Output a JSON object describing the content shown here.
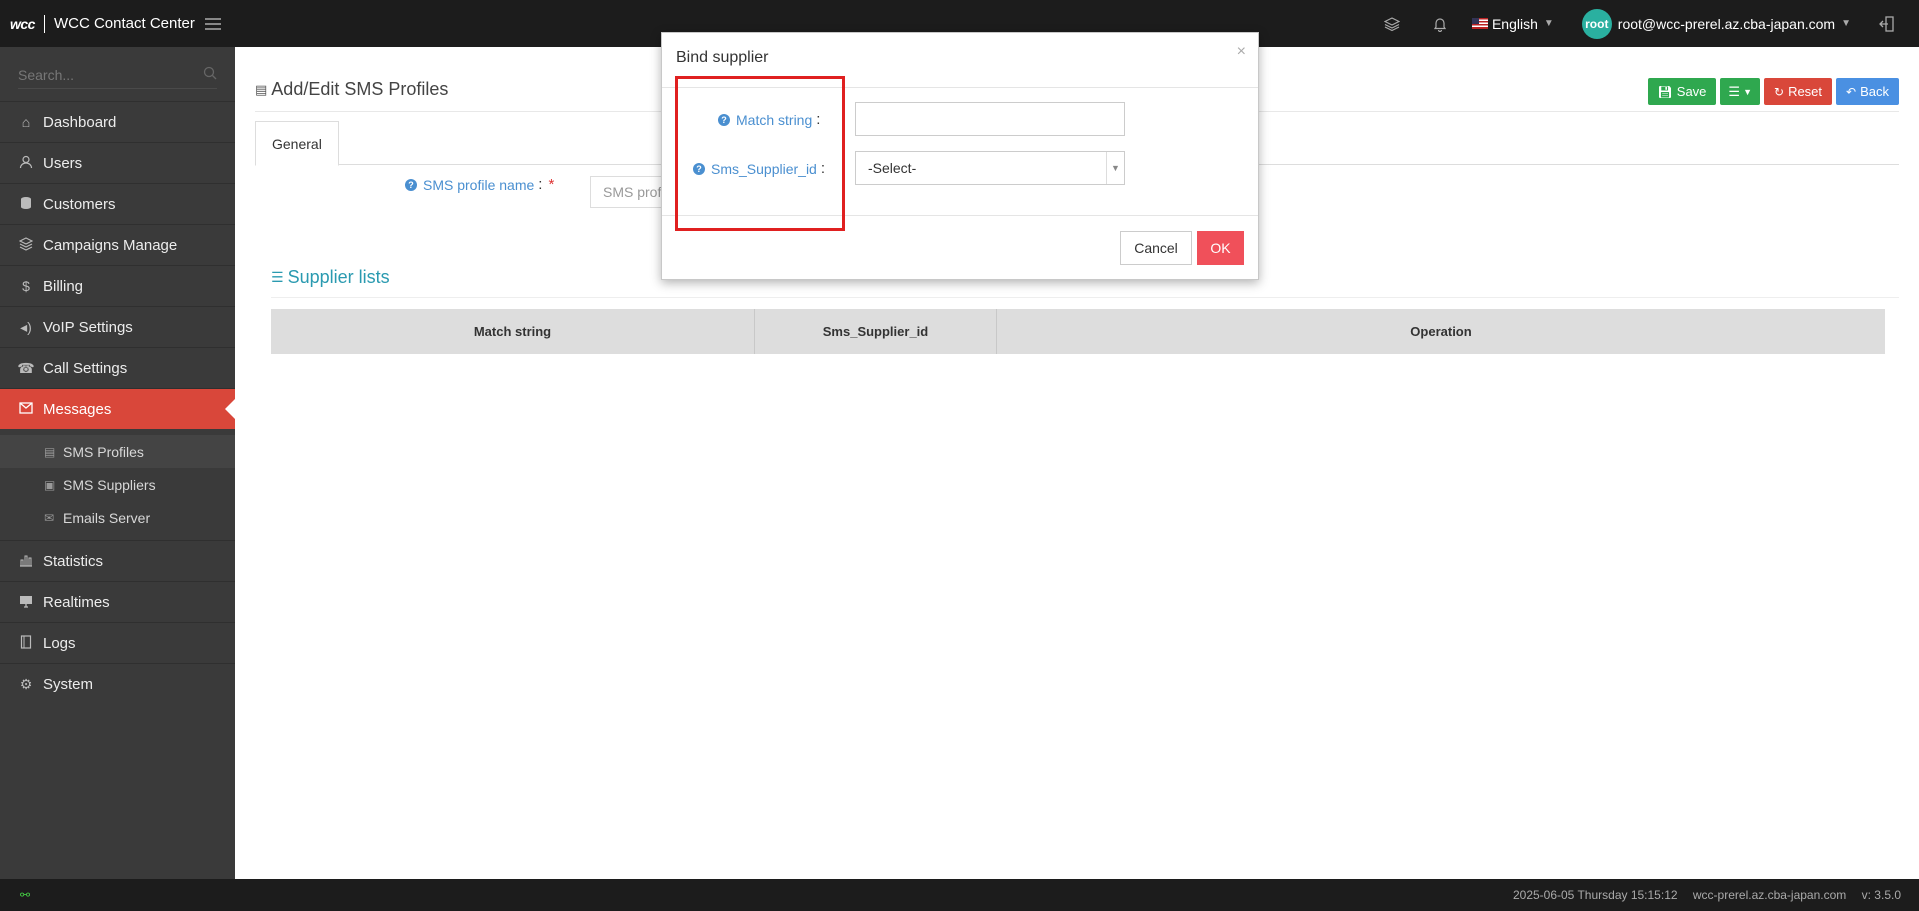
{
  "header": {
    "logo": "wcc",
    "app_title": "WCC Contact Center",
    "language": "English",
    "user_avatar": "root",
    "user_email": "root@wcc-prerel.az.cba-japan.com"
  },
  "sidebar": {
    "search_placeholder": "Search...",
    "items": [
      {
        "label": "Dashboard",
        "icon": "home-icon"
      },
      {
        "label": "Users",
        "icon": "user-icon"
      },
      {
        "label": "Customers",
        "icon": "database-icon"
      },
      {
        "label": "Campaigns Manage",
        "icon": "layers-icon"
      },
      {
        "label": "Billing",
        "icon": "dollar-icon"
      },
      {
        "label": "VoIP Settings",
        "icon": "volume-icon"
      },
      {
        "label": "Call Settings",
        "icon": "phone-icon"
      },
      {
        "label": "Messages",
        "icon": "envelope-icon"
      }
    ],
    "sub_items": [
      {
        "label": "SMS Profiles",
        "icon": "file-icon"
      },
      {
        "label": "SMS Suppliers",
        "icon": "briefcase-icon"
      },
      {
        "label": "Emails Server",
        "icon": "mail-icon"
      }
    ],
    "items_after": [
      {
        "label": "Statistics",
        "icon": "bar-chart-icon"
      },
      {
        "label": "Realtimes",
        "icon": "monitor-icon"
      },
      {
        "label": "Logs",
        "icon": "book-icon"
      },
      {
        "label": "System",
        "icon": "gear-icon"
      }
    ]
  },
  "page": {
    "title": "Add/Edit SMS Profiles",
    "buttons": {
      "save": "Save",
      "reset": "Reset",
      "back": "Back"
    },
    "tab_general": "General",
    "profile_name_label": "SMS profile name",
    "profile_name_placeholder": "SMS profile name",
    "section_title": "Supplier lists",
    "table_headers": [
      "Match string",
      "Sms_Supplier_id",
      "Operation"
    ]
  },
  "modal": {
    "title": "Bind supplier",
    "match_label": "Match string",
    "supplier_label": "Sms_Supplier_id",
    "select_value": "-Select-",
    "cancel": "Cancel",
    "ok": "OK"
  },
  "footer": {
    "datetime": "2025-06-05 Thursday 15:15:12",
    "host": "wcc-prerel.az.cba-japan.com",
    "version": "v: 3.5.0"
  },
  "colors": {
    "active_nav": "#d9473a",
    "save": "#2fa84f",
    "reset": "#d9473a",
    "back": "#4a90e2",
    "ok": "#f0505a",
    "highlight": "#e02020"
  }
}
